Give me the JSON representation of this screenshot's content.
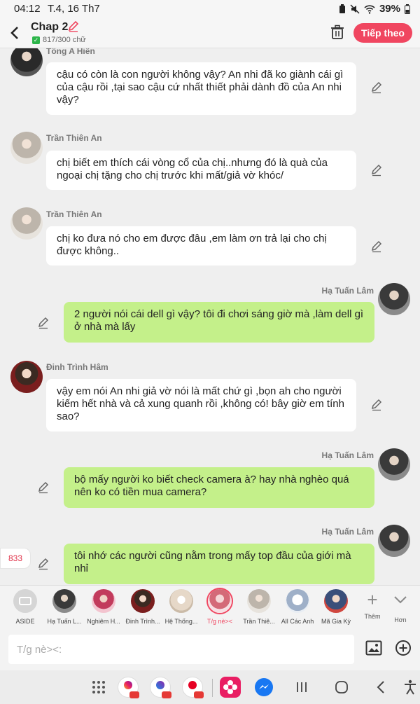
{
  "status": {
    "time": "04:12",
    "date": "T.4, 16 Th7",
    "battery": "39%"
  },
  "header": {
    "title": "Chap 2",
    "word_count": "817/300 chữ",
    "next_label": "Tiếp theo"
  },
  "messages": [
    {
      "name": "Tống A Hiên",
      "text": "cậu có còn là con người không vậy? An nhi đã ko giành cái gì của cậu rồi ,tại sao cậu cứ nhất thiết phải dành đồ của An nhi vậy?"
    },
    {
      "name": "Trần Thiên An",
      "text": "chị biết em thích cái vòng cổ của chị..nhưng đó là quà của ngoại chị tặng cho chị trước khi mất/giả vờ khóc/"
    },
    {
      "name": "Trần Thiên An",
      "text": "chị ko đưa nó cho em được đâu ,em làm ơn trả lại cho chị được không.."
    },
    {
      "name": "Hạ Tuấn Lâm",
      "text": "2 người nói cái dell gì vậy? tôi đi chơi sáng giờ mà ,làm dell gì ở nhà mà lấy"
    },
    {
      "name": "Đinh Trình Hâm",
      "text": "vậy em nói An nhi giả vờ nói là mất chứ gì ,bọn ah cho người kiếm hết nhà và cả xung quanh rồi ,không có! bây giờ em tính sao?"
    },
    {
      "name": "Hạ Tuấn Lâm",
      "text": "bộ mấy người ko biết check camera à? hay nhà nghèo quá nên ko có tiền mua camera?"
    },
    {
      "name": "Hạ Tuấn Lâm",
      "text": "tôi nhớ các người cũng nằm trong mấy top đầu của giới mà nhỉ"
    }
  ],
  "count_badge": "833",
  "characters": [
    {
      "label": "ASIDE"
    },
    {
      "label": "Hạ Tuấn L..."
    },
    {
      "label": "Nghiêm H..."
    },
    {
      "label": "Đinh Trình..."
    },
    {
      "label": "Hệ Thống..."
    },
    {
      "label": "T/g nè><"
    },
    {
      "label": "Trần Thiê..."
    },
    {
      "label": "All Các Anh"
    },
    {
      "label": "Mã Gia Kỳ"
    }
  ],
  "tools": {
    "add_label": "Thêm",
    "more_label": "Hơn"
  },
  "input": {
    "placeholder": "T/g nè><:"
  },
  "colors": {
    "accent": "#f04660",
    "bubble_self": "#c4f08a",
    "bubble_other": "#ffffff",
    "background": "#efefef"
  }
}
